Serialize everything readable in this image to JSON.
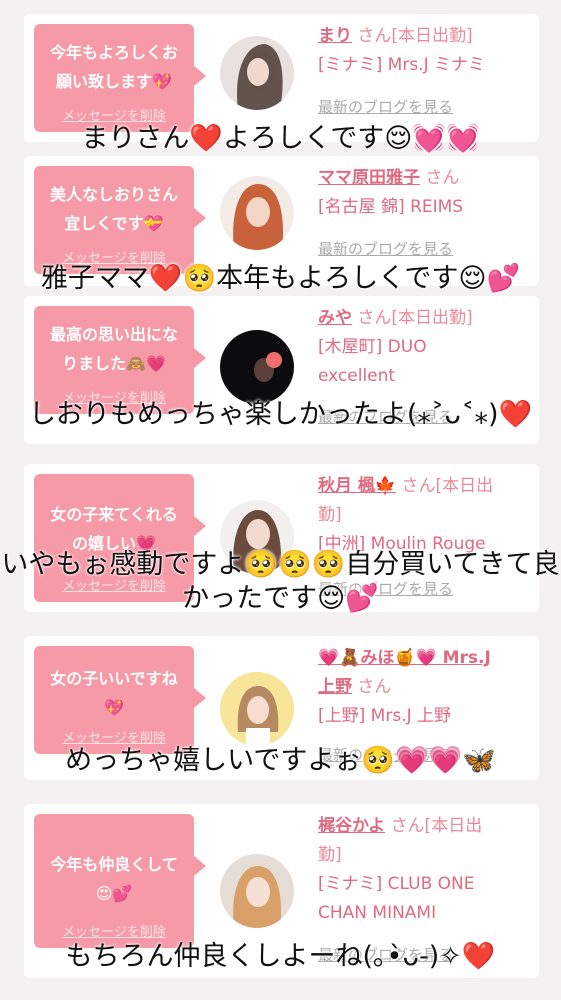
{
  "messages": [
    {
      "bubble": "今年もよろしくお\n願い致します💖",
      "delete": "メッセージを削除",
      "name": "まり",
      "suffix": "さん[本日出勤]",
      "store": "[ミナミ] Mrs.J ミナミ",
      "blog": "最新のブログを見る",
      "caption": "まりさん❤️よろしくです😌💓💓"
    },
    {
      "bubble": "美人なしおりさん\n宜しくです💝",
      "delete": "メッセージを削除",
      "name": "ママ原田雅子",
      "suffix": "さん",
      "store": "[名古屋 錦] REIMS",
      "blog": "最新のブログを見る",
      "caption": "雅子ママ❤️🥺本年もよろしくです😌💕"
    },
    {
      "bubble": "最高の思い出にな\nりました🙈💗",
      "delete": "メッセージを削除",
      "name": "みや",
      "suffix": "さん[本日出勤]",
      "store": "[木屋町] DUO\nexcellent",
      "blog": "最新のブログを見る",
      "caption": "しおりもめっちゃ楽しかったよ(⁎˃ᴗ˂⁎)❤️"
    },
    {
      "bubble": "女の子来てくれる\nの嬉しい💗",
      "delete": "メッセージを削除",
      "name": "秋月 楓🍁",
      "suffix": "さん[本日出\n勤]",
      "store": "[中洲] Moulin Rouge",
      "blog": "最新のブログを見る",
      "caption": "いやもぉ感動ですよ🥺🥺🥺自分買いてきて良かったです😌💕"
    },
    {
      "bubble": "女の子いいですね\n💖",
      "delete": "メッセージを削除",
      "name": "💗🧸みほ🍯💗 Mrs.J\n上野",
      "suffix": "さん",
      "store": "[上野] Mrs.J 上野",
      "blog": "最新のブログを見る",
      "caption": "めっちゃ嬉しいですよぉ🥺💗💗🦋"
    },
    {
      "bubble": "今年も仲良くして\n😍💕",
      "delete": "メッセージを削除",
      "name": "梶谷かよ",
      "suffix": "さん[本日出\n勤]",
      "store": "[ミナミ] CLUB ONE\nCHAN MINAMI",
      "blog": "最新のブログを見る",
      "caption": "もちろん仲良くしよーね(｡•̀ᴗ-)✧❤️"
    }
  ],
  "colors": {
    "bubble": "#f59aa6",
    "accent": "#e06a80",
    "background": "#f3f1f2"
  }
}
